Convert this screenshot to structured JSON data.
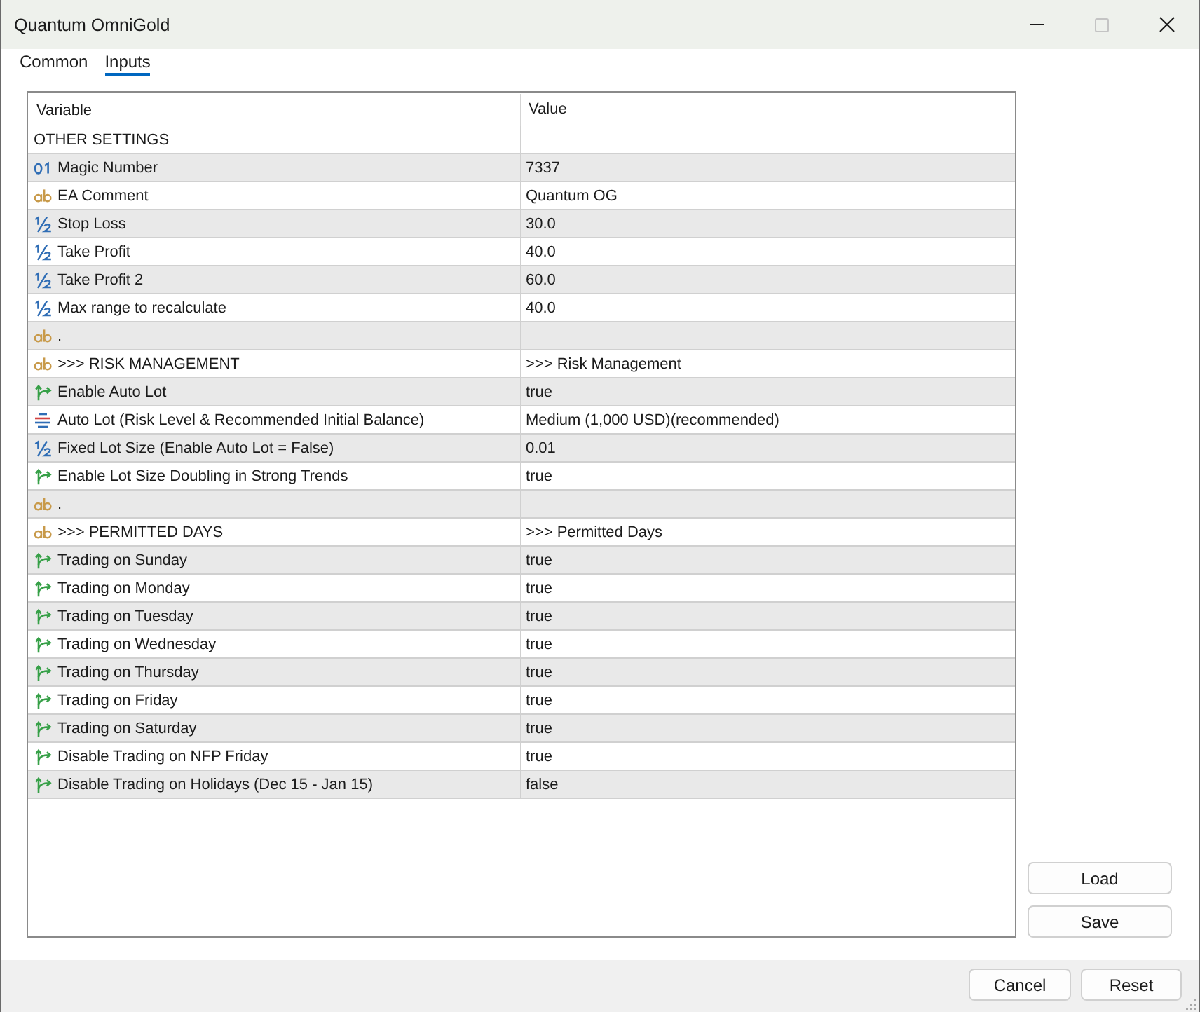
{
  "window": {
    "title": "Quantum OmniGold",
    "controls": [
      {
        "kind": "minimize",
        "disabled": false
      },
      {
        "kind": "maximize",
        "disabled": true
      },
      {
        "kind": "close",
        "disabled": false
      }
    ]
  },
  "tabs": [
    {
      "label": "Common",
      "selected": false
    },
    {
      "label": "Inputs",
      "selected": true
    }
  ],
  "table": {
    "columns": [
      "Variable",
      "Value"
    ],
    "rows": [
      {
        "kind": "group",
        "variable": "OTHER SETTINGS"
      },
      {
        "kind": "int",
        "variable": "Magic Number",
        "value": "7337"
      },
      {
        "kind": "string",
        "variable": "EA Comment",
        "value": "Quantum OG"
      },
      {
        "kind": "double",
        "variable": "Stop Loss",
        "value": "30.0"
      },
      {
        "kind": "double",
        "variable": "Take Profit",
        "value": "40.0"
      },
      {
        "kind": "double",
        "variable": "Take Profit 2",
        "value": "60.0"
      },
      {
        "kind": "double",
        "variable": "Max range to recalculate",
        "value": "40.0"
      },
      {
        "kind": "string",
        "variable": "."
      },
      {
        "kind": "string",
        "variable": ">>> RISK MANAGEMENT",
        "value": ">>> Risk Management"
      },
      {
        "kind": "bool",
        "variable": "Enable Auto Lot",
        "value": "true"
      },
      {
        "kind": "enum",
        "variable": "Auto Lot (Risk Level & Recommended Initial Balance)",
        "value": "Medium (1,000 USD)(recommended)"
      },
      {
        "kind": "double",
        "variable": "Fixed Lot Size (Enable Auto Lot = False)",
        "value": "0.01"
      },
      {
        "kind": "bool",
        "variable": "Enable Lot Size Doubling in Strong Trends",
        "value": "true"
      },
      {
        "kind": "string",
        "variable": "."
      },
      {
        "kind": "string",
        "variable": ">>> PERMITTED DAYS",
        "value": ">>> Permitted Days"
      },
      {
        "kind": "bool",
        "variable": "Trading on Sunday",
        "value": "true"
      },
      {
        "kind": "bool",
        "variable": "Trading on Monday",
        "value": "true"
      },
      {
        "kind": "bool",
        "variable": "Trading on Tuesday",
        "value": "true"
      },
      {
        "kind": "bool",
        "variable": "Trading on Wednesday",
        "value": "true"
      },
      {
        "kind": "bool",
        "variable": "Trading on Thursday",
        "value": "true"
      },
      {
        "kind": "bool",
        "variable": "Trading on Friday",
        "value": "true"
      },
      {
        "kind": "bool",
        "variable": "Trading on Saturday",
        "value": "true"
      },
      {
        "kind": "bool",
        "variable": "Disable Trading on NFP Friday",
        "value": "true"
      },
      {
        "kind": "bool",
        "variable": "Disable Trading on Holidays (Dec 15 - Jan 15)",
        "value": "false"
      }
    ]
  },
  "side_buttons": [
    "Load",
    "Save"
  ],
  "footer_buttons": [
    "Cancel",
    "Reset"
  ]
}
